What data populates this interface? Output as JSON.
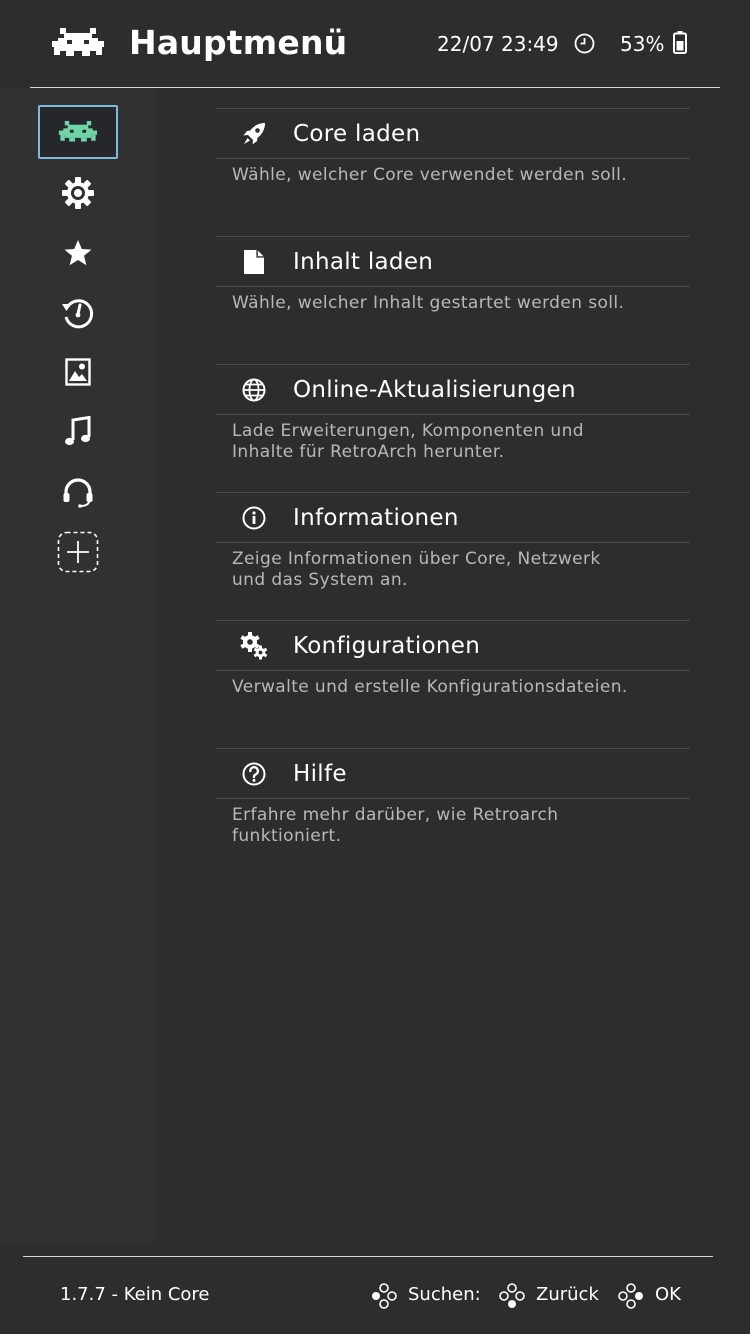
{
  "header": {
    "title": "Hauptmenü",
    "datetime": "22/07 23:49",
    "battery": "53%"
  },
  "sidebar": {
    "items": [
      {
        "name": "main-menu",
        "icon": "retroarch-invader-icon",
        "selected": true
      },
      {
        "name": "settings",
        "icon": "gear-icon"
      },
      {
        "name": "favorites",
        "icon": "star-icon"
      },
      {
        "name": "history",
        "icon": "history-icon"
      },
      {
        "name": "images",
        "icon": "image-icon"
      },
      {
        "name": "music",
        "icon": "music-note-icon"
      },
      {
        "name": "netplay",
        "icon": "headset-icon"
      },
      {
        "name": "add",
        "icon": "add-icon"
      }
    ]
  },
  "menu": {
    "items": [
      {
        "label": "Core laden",
        "description": "Wähle, welcher Core verwendet werden soll.",
        "icon": "rocket-icon"
      },
      {
        "label": "Inhalt laden",
        "description": "Wähle, welcher Inhalt gestartet werden soll.",
        "icon": "file-icon"
      },
      {
        "label": "Online-Aktualisierungen",
        "description": "Lade Erweiterungen, Komponenten und Inhalte für RetroArch herunter.",
        "icon": "globe-icon"
      },
      {
        "label": "Informationen",
        "description": "Zeige Informationen über Core, Netzwerk und das System an.",
        "icon": "info-icon"
      },
      {
        "label": "Konfigurationen",
        "description": "Verwalte und erstelle Konfigurationsdateien.",
        "icon": "gears-icon"
      },
      {
        "label": "Hilfe",
        "description": "Erfahre mehr darüber, wie Retroarch funktioniert.",
        "icon": "help-icon"
      }
    ]
  },
  "footer": {
    "version": "1.7.7 - Kein Core",
    "search_label": "Suchen:",
    "back_label": "Zurück",
    "ok_label": "OK"
  },
  "colors": {
    "background": "#2d2d2d",
    "sidebar": "#313131",
    "selection_border": "#7dbcd9",
    "accent_invader": "#6fd4a8"
  }
}
